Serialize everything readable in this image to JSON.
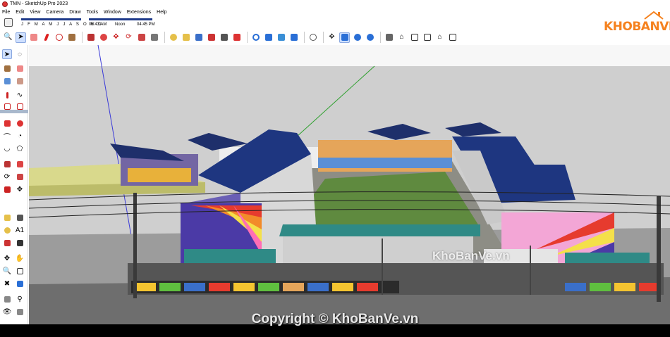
{
  "window": {
    "title": "TMN - SketchUp Pro 2023"
  },
  "menu": [
    "File",
    "Edit",
    "View",
    "Camera",
    "Draw",
    "Tools",
    "Window",
    "Extensions",
    "Help"
  ],
  "shadows": {
    "months": "J F M A M J J A S O N D",
    "time_start": "06:43 AM",
    "noon_label": "Noon",
    "time_end": "04:45 PM"
  },
  "toolbar_icons": [
    "search-icon",
    "select-arrow-icon",
    "eraser-icon",
    "pencil-icon",
    "shape-icon",
    "paint-bucket-icon",
    "push-pull-icon",
    "follow-me-icon",
    "move-icon",
    "rotate-icon",
    "scale-icon",
    "offset-icon",
    "tape-measure-icon",
    "protractor-icon",
    "text-icon",
    "axes-icon",
    "dimension-icon",
    "3d-text-icon",
    "orbit-icon",
    "pan-icon",
    "zoom-icon",
    "zoom-extents-icon",
    "section-icon",
    "sandbox-icon",
    "user-icon",
    "walk-icon",
    "look-around-icon",
    "position-camera-icon",
    "iso-view-icon",
    "top-view-icon",
    "front-view-icon",
    "right-view-icon",
    "back-view-icon",
    "left-view-icon"
  ],
  "logo": {
    "text": "KHOBANVE",
    "accent": "#f5821f"
  },
  "watermark": "KhoBanVe.vn",
  "copyright": "Copyright © KhoBanVe.vn"
}
